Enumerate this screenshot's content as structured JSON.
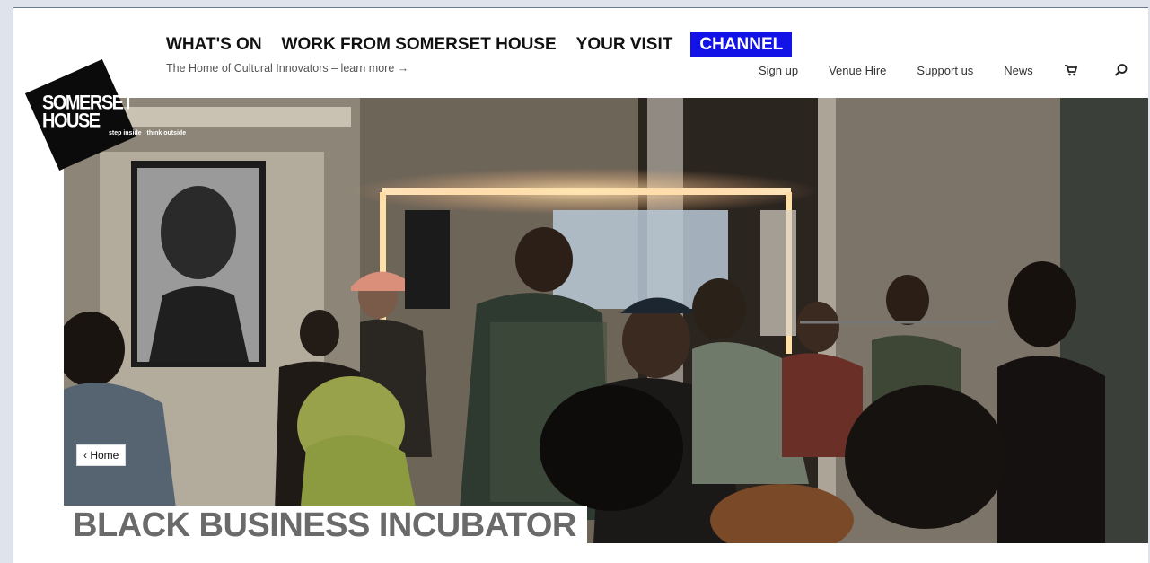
{
  "header": {
    "logo": {
      "line1": "SOMERSET",
      "line2": "HOUSE",
      "tag1": "step inside",
      "tag2": "think outside"
    },
    "main_nav": [
      "WHAT'S ON",
      "WORK FROM SOMERSET HOUSE",
      "YOUR VISIT"
    ],
    "channel_label": "CHANNEL",
    "tagline": "The Home of Cultural Innovators – learn more  →",
    "util_nav": {
      "signup": "Sign up",
      "venue_hire": "Venue Hire",
      "support": "Support us",
      "news": "News"
    },
    "icons": {
      "basket": "basket-icon",
      "search": "search-icon"
    }
  },
  "hero": {
    "breadcrumb": "‹ Home",
    "title": "BLACK BUSINESS INCUBATOR"
  },
  "colors": {
    "channel_bg": "#1313e8",
    "title_text": "#6a6a6a"
  }
}
